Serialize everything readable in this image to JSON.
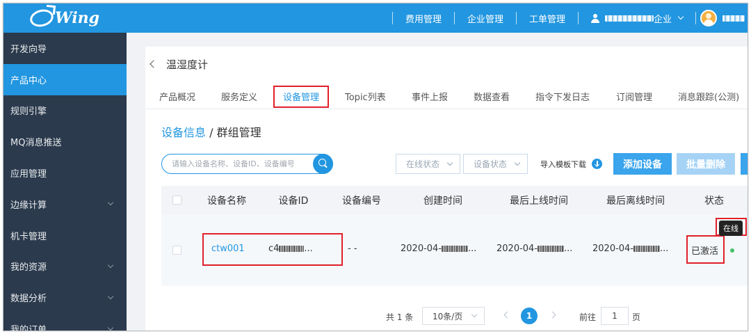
{
  "brand": {
    "logo_text": "Wing"
  },
  "topbar": {
    "nav": [
      "费用管理",
      "企业管理",
      "工单管理"
    ],
    "company_suffix": "企业"
  },
  "sidebar": {
    "items": [
      {
        "label": "开发向导",
        "expandable": false,
        "active": false
      },
      {
        "label": "产品中心",
        "expandable": false,
        "active": true
      },
      {
        "label": "规则引擎",
        "expandable": false,
        "active": false
      },
      {
        "label": "MQ消息推送",
        "expandable": false,
        "active": false
      },
      {
        "label": "应用管理",
        "expandable": false,
        "active": false
      },
      {
        "label": "边缘计算",
        "expandable": true,
        "active": false
      },
      {
        "label": "机卡管理",
        "expandable": false,
        "active": false
      },
      {
        "label": "我的资源",
        "expandable": true,
        "active": false
      },
      {
        "label": "数据分析",
        "expandable": true,
        "active": false
      },
      {
        "label": "我的订单",
        "expandable": true,
        "active": false
      }
    ]
  },
  "page": {
    "title": "温湿度计"
  },
  "tabs": [
    {
      "label": "产品概况",
      "active": false
    },
    {
      "label": "服务定义",
      "active": false
    },
    {
      "label": "设备管理",
      "active": true
    },
    {
      "label": "Topic列表",
      "active": false
    },
    {
      "label": "事件上报",
      "active": false
    },
    {
      "label": "数据查看",
      "active": false
    },
    {
      "label": "指令下发日志",
      "active": false
    },
    {
      "label": "订阅管理",
      "active": false
    },
    {
      "label": "消息跟踪(公测)",
      "active": false
    }
  ],
  "breadcrumb": {
    "link": "设备信息",
    "separator": "/",
    "current": "群组管理"
  },
  "toolbar": {
    "search_placeholder": "请输入设备名称、设备ID、设备编号",
    "online_status": "在线状态",
    "device_status": "设备状态",
    "template_download": "导入模板下载",
    "add_device": "添加设备",
    "batch_delete": "批量删除"
  },
  "table": {
    "columns": [
      "设备名称",
      "设备ID",
      "设备编号",
      "创建时间",
      "最后上线时间",
      "最后离线时间",
      "状态"
    ],
    "rows": [
      {
        "name": "ctw001",
        "id_prefix": "c4",
        "id_suffix": "...",
        "number": "- -",
        "created_prefix": "2020-04-",
        "created_suffix": "...",
        "last_online_prefix": "2020-04-",
        "last_online_suffix": "...",
        "last_offline_prefix": "2020-04-",
        "last_offline_suffix": "...",
        "status": "已激活",
        "online_tooltip": "在线"
      }
    ]
  },
  "pagination": {
    "total": "共 1 条",
    "page_size": "10条/页",
    "current_page": "1",
    "goto_label": "前往",
    "goto_value": "1",
    "page_unit": "页"
  },
  "colors": {
    "primary": "#2296e0",
    "sidebar_bg": "#2b3a4c",
    "highlight_box": "#e0202a",
    "online_dot": "#43c16b"
  }
}
